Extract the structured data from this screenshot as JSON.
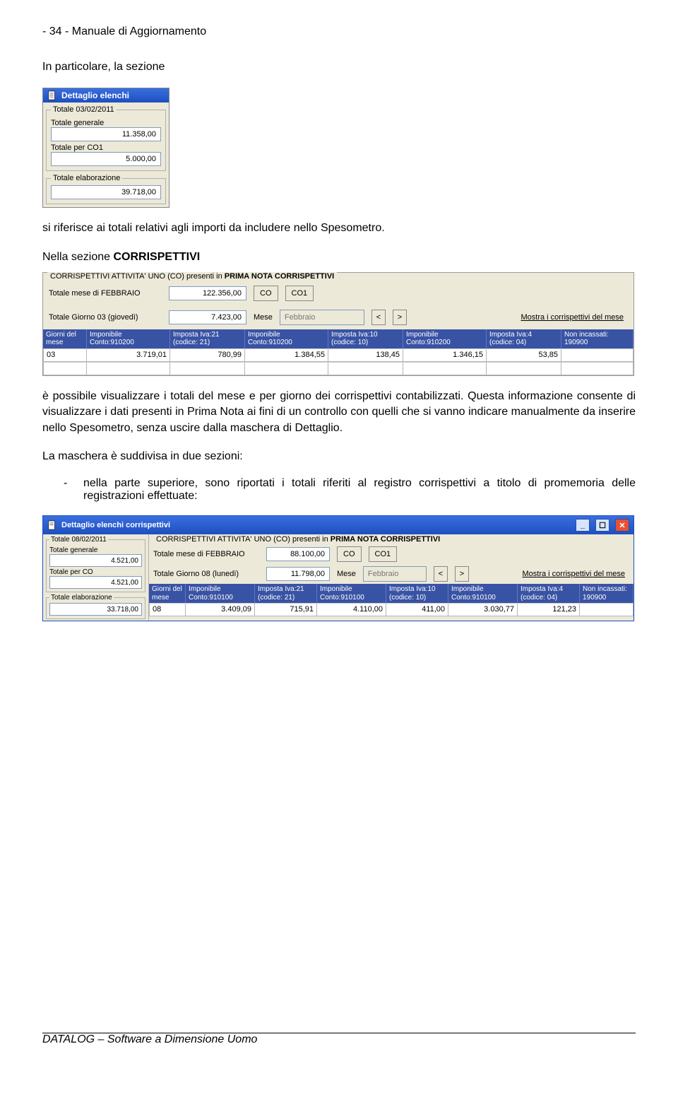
{
  "page": {
    "header": "- 34 -  Manuale di Aggiornamento",
    "p1": "In particolare, la sezione",
    "p2": "si riferisce ai totali relativi agli importi da includere nello Spesometro.",
    "p3_pre": "Nella sezione ",
    "p3_bold": "CORRISPETTIVI",
    "p4": "è possibile visualizzare i totali del mese e per giorno dei corrispettivi contabilizzati. Questa informazione consente di visualizzare i dati presenti in Prima Nota ai fini di un controllo con quelli che si vanno indicare manualmente da inserire nello Spesometro, senza uscire dalla maschera di Dettaglio.",
    "p5": "La maschera è suddivisa in due sezioni:",
    "bullet1": "nella parte superiore, sono riportati i totali riferiti al registro corrispettivi a titolo di promemoria delle registrazioni effettuate:",
    "footer": "DATALOG – Software a Dimensione Uomo"
  },
  "dett": {
    "title": "Dettaglio elenchi",
    "fs1_legend": "Totale 03/02/2011",
    "l_tot_gen": "Totale generale",
    "v_tot_gen": "11.358,00",
    "l_tot_co1": "Totale per CO1",
    "v_tot_co1": "5.000,00",
    "fs2_legend": "Totale elaborazione",
    "v_tot_elab": "39.718,00"
  },
  "cor1": {
    "legendA": "CORRISPETTIVI ATTIVITA' UNO   (CO)  presenti in ",
    "legendB": "PRIMA NOTA  CORRISPETTIVI",
    "l_mese": "Totale mese di FEBBRAIO",
    "v_mese": "122.356,00",
    "btn_co": "CO",
    "btn_co1": "CO1",
    "l_giorno": "Totale Giorno 03 (giovedì)",
    "v_giorno": "7.423,00",
    "l_mese_sel": "Mese",
    "sel_mese": "Febbraio",
    "nav_prev": "<",
    "nav_next": ">",
    "link_mostra": "Mostra i corrispettivi del mese",
    "hdr": [
      "Giorni del\nmese",
      "Imponibile\nConto:910200",
      "Imposta Iva:21\n(codice: 21)",
      "Imponibile\nConto:910200",
      "Imposta Iva:10\n(codice: 10)",
      "Imponibile\nConto:910200",
      "Imposta Iva:4\n(codice: 04)",
      "Non incassati:\n190900"
    ],
    "row": [
      "03",
      "3.719,01",
      "780,99",
      "1.384,55",
      "138,45",
      "1.346,15",
      "53,85",
      ""
    ]
  },
  "win": {
    "title": "Dettaglio elenchi corrispettivi",
    "left": {
      "fs1_legend": "Totale 08/02/2011",
      "l_tot_gen": "Totale generale",
      "v_tot_gen": "4.521,00",
      "l_tot_co": "Totale per CO",
      "v_tot_co": "4.521,00",
      "fs2_legend": "Totale elaborazione",
      "v_tot_elab": "33.718,00"
    },
    "right": {
      "legendA": "CORRISPETTIVI ATTIVITA' UNO   (CO)  presenti in ",
      "legendB": "PRIMA NOTA  CORRISPETTIVI",
      "l_mese": "Totale mese di FEBBRAIO",
      "v_mese": "88.100,00",
      "btn_co": "CO",
      "btn_co1": "CO1",
      "l_giorno": "Totale Giorno 08 (lunedì)",
      "v_giorno": "11.798,00",
      "l_mese_sel": "Mese",
      "sel_mese": "Febbraio",
      "nav_prev": "<",
      "nav_next": ">",
      "link_mostra": "Mostra i corrispettivi del mese",
      "hdr": [
        "Giorni del\nmese",
        "Imponibile\nConto:910100",
        "Imposta Iva:21\n(codice: 21)",
        "Imponibile\nConto:910100",
        "Imposta Iva:10\n(codice: 10)",
        "Imponibile\nConto:910100",
        "Imposta Iva:4\n(codice: 04)",
        "Non incassati:\n190900"
      ],
      "row": [
        "08",
        "3.409,09",
        "715,91",
        "4.110,00",
        "411,00",
        "3.030,77",
        "121,23",
        ""
      ]
    }
  }
}
